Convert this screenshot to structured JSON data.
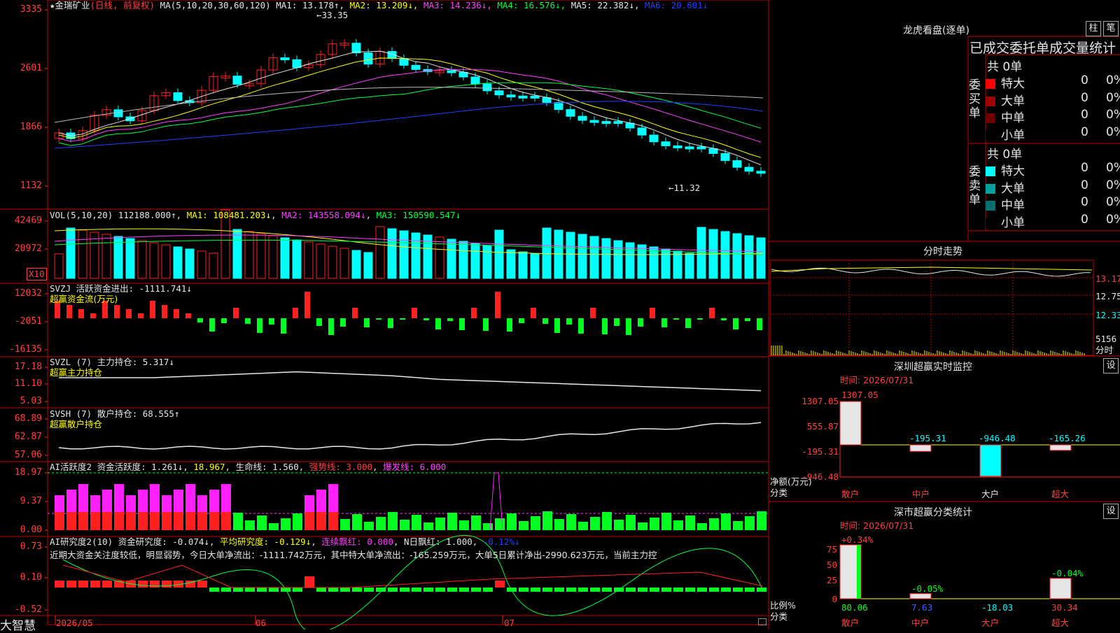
{
  "stock": {
    "name": "★金瑞矿业",
    "mode": "(日线, 前复权)",
    "ma_label": "MA(5,10,20,30,60,120)",
    "ma_values": [
      {
        "label": "MA1: 13.178↑",
        "color": "#e6e6e6"
      },
      {
        "label": "MA2: 13.209↓",
        "color": "#ffff00"
      },
      {
        "label": "MA3: 14.236↓",
        "color": "#ff40ff"
      },
      {
        "label": "MA4: 16.576↓",
        "color": "#00ff40"
      },
      {
        "label": "MA5: 22.382↓",
        "color": "#e6e6e6"
      },
      {
        "label": "MA6: 20.601↓",
        "color": "#2040ff"
      }
    ],
    "high_mark": "←33.35",
    "low_mark": "←11.32",
    "y_ticks": [
      "3335",
      "2601",
      "1866",
      "1132"
    ]
  },
  "vol": {
    "label": "VOL(5,10,20)",
    "value": "112188.000↑",
    "ma1": "MA1: 108481.203↓",
    "ma2": "MA2: 143558.094↓",
    "ma3": "MA3: 150590.547↓",
    "y_ticks": [
      "42469",
      "20972"
    ],
    "unit": "X10"
  },
  "svzj": {
    "label": "SVZJ  活跃资金进出: -1111.741↓",
    "sub": "超赢资金流(万元)",
    "y_ticks": [
      "12032",
      "-2051",
      "-16135"
    ]
  },
  "svzl": {
    "label": "SVZL (7) 主力持仓: 5.317↓",
    "sub": "超赢主力持仓",
    "y_ticks": [
      "17.18",
      "11.10",
      "5.03"
    ]
  },
  "svsh": {
    "label": "SVSH (7) 散户持仓: 68.555↑",
    "sub": "超赢散户持仓",
    "y_ticks": [
      "68.89",
      "62.87",
      "57.06"
    ]
  },
  "ai_active": {
    "label": "AI活跃度2 资金活跃度: 1.261↓",
    "v1": "18.967",
    "v2": "生命线: 1.560",
    "v3": "强势线: 3.000",
    "v4": "爆发线: 6.000",
    "y_ticks": [
      "18.97",
      "9.37",
      "0.00"
    ]
  },
  "ai_research": {
    "label": "AI研究度2(10) 资金研究度: -0.074↓",
    "v1": "平均研究度: -0.129↓",
    "v2": "连续飘红: 0.000",
    "v3": "N日飘红: 1.000",
    "v4": "-0.12%↓",
    "commentary": "近期大资金关注度较低，明显弱势，今日大单净流出：-1111.742万元，其中特大单净流出：-165.259万元，大单5日累计净出-2990.623万元，当前主力控",
    "y_ticks": [
      "0.73",
      "0.10",
      "-0.52"
    ]
  },
  "bottom": {
    "brand": "大智慧",
    "dates": [
      "2026/05",
      "06",
      "07"
    ]
  },
  "dragon_tiger": {
    "title": "龙虎看盘(逐单)",
    "btn1": "柱",
    "btn2": "笔",
    "subtitle": "已成交委托单成交量统计",
    "buy_label": "委买单",
    "sell_label": "委卖单",
    "buy_total": "共 0单",
    "sell_total": "共 0单",
    "buy_rows": [
      {
        "name": "特大",
        "count": "0",
        "pct": "0%",
        "color": "#ff0000"
      },
      {
        "name": "大单",
        "count": "0",
        "pct": "0%",
        "color": "#a00000"
      },
      {
        "name": "中单",
        "count": "0",
        "pct": "0%",
        "color": "#700000"
      },
      {
        "name": "小单",
        "count": "0",
        "pct": "0%",
        "color": "#000000"
      }
    ],
    "sell_rows": [
      {
        "name": "特大",
        "count": "0",
        "pct": "0%",
        "color": "#00ffff"
      },
      {
        "name": "大单",
        "count": "0",
        "pct": "0%",
        "color": "#00a0a0"
      },
      {
        "name": "中单",
        "count": "0",
        "pct": "0%",
        "color": "#007070"
      },
      {
        "name": "小单",
        "count": "0",
        "pct": "0%",
        "color": "#000000"
      }
    ]
  },
  "intraday": {
    "title": "分时走势",
    "y_ticks": [
      "13.17",
      "12.75",
      "12.33"
    ],
    "vol_tick": "5156",
    "unit": "分时"
  },
  "sz_monitor": {
    "title": "深圳超赢实时监控",
    "btn": "设",
    "time": "时间: 2026/07/31",
    "y_ticks": [
      "1307.05",
      "555.87",
      "-195.31",
      "-946.48"
    ],
    "ylabel": "净额(万元)",
    "xlabel": "分类",
    "categories": [
      "散户",
      "中户",
      "大户",
      "超大"
    ],
    "values": [
      1307.05,
      -195.31,
      -946.48,
      -165.26
    ],
    "value_labels": [
      "1307.05",
      "-195.31",
      "-946.48",
      "-165.26"
    ]
  },
  "sz_classify": {
    "title": "深市超赢分类统计",
    "btn": "设",
    "time": "时间: 2026/07/31",
    "y_ticks": [
      "75",
      "50",
      "25",
      "0"
    ],
    "ylabel": "比例%",
    "xlabel": "分类",
    "categories": [
      "散户",
      "中户",
      "大户",
      "超大"
    ],
    "values": [
      80.06,
      7.63,
      -18.03,
      30.34
    ],
    "value_labels": [
      "80.06",
      "7.63",
      "-18.03",
      "30.34"
    ],
    "change_labels": [
      "+0.34%",
      "-0.05%",
      "",
      "-0.04%"
    ]
  }
}
